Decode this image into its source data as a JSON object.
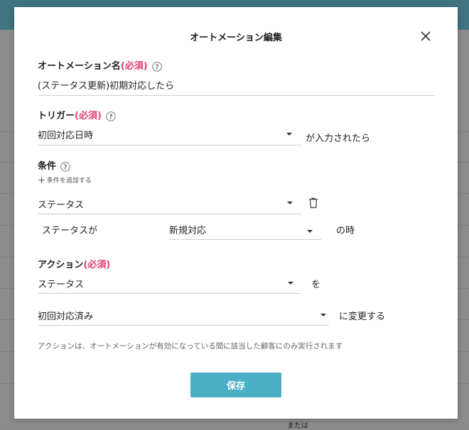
{
  "background": {
    "partial_text": "または"
  },
  "modal": {
    "title": "オートメーション編集",
    "name_section": {
      "label": "オートメーション名",
      "required": "(必須)",
      "value": "(ステータス更新)初期対応したら"
    },
    "trigger_section": {
      "label": "トリガー",
      "required": "(必須)",
      "selected": "初回対応日時",
      "suffix": "が入力されたら"
    },
    "condition_section": {
      "label": "条件",
      "add_label": "条件を追加する",
      "condition_field": "ステータス",
      "prefix": "ステータスが",
      "value": "新規対応",
      "suffix": "の時"
    },
    "action_section": {
      "label": "アクション",
      "required": "(必須)",
      "field": "ステータス",
      "particle": "を",
      "value": "初回対応済み",
      "suffix": "に変更する"
    },
    "note": "アクションは、オートメーションが有効になっている間に該当した顧客にのみ実行されます",
    "save_label": "保存"
  },
  "colors": {
    "accent": "#4aaec5",
    "required": "#e0407a"
  },
  "icons": [
    "close-icon",
    "help-icon",
    "plus-icon",
    "chevron-down-icon",
    "trash-icon"
  ]
}
